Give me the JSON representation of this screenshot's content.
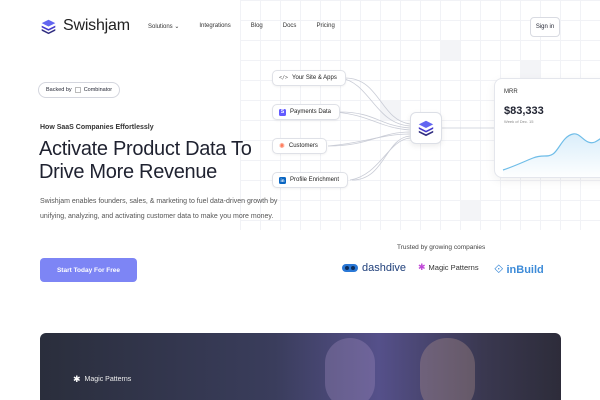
{
  "nav": {
    "logo_text": "Swishjam",
    "links": [
      "Solutions ⌄",
      "Integrations",
      "Blog",
      "Docs",
      "Pricing"
    ],
    "signin": "Sign in"
  },
  "hero": {
    "badge_prefix": "Backed by",
    "badge_logo_alt": "Combinator",
    "kicker": "How SaaS Companies Effortlessly",
    "headline": "Activate Product Data To Drive More Revenue",
    "subtext": "Swishjam enables founders, sales, & marketing to fuel data-driven growth by unifying, analyzing, and activating customer data to make you more money.",
    "cta": "Start Today For Free"
  },
  "diagram": {
    "sources": [
      {
        "label": "Your Site & Apps",
        "icon": "code-icon"
      },
      {
        "label": "Payments Data",
        "icon": "stripe-icon"
      },
      {
        "label": "Customers",
        "icon": "hubspot-icon"
      },
      {
        "label": "Profile Enrichment",
        "icon": "linkedin-icon"
      }
    ],
    "mrr": {
      "label": "MRR",
      "value": "$83,333",
      "date": "Week of Dec. 15"
    }
  },
  "trusted": {
    "label": "Trusted by growing companies",
    "brands": [
      "dashdive",
      "Magic Patterns",
      "inBuild"
    ]
  },
  "video": {
    "brand": "Magic Patterns"
  },
  "colors": {
    "accent": "#7d85f5",
    "primary_text": "#1f2230"
  }
}
